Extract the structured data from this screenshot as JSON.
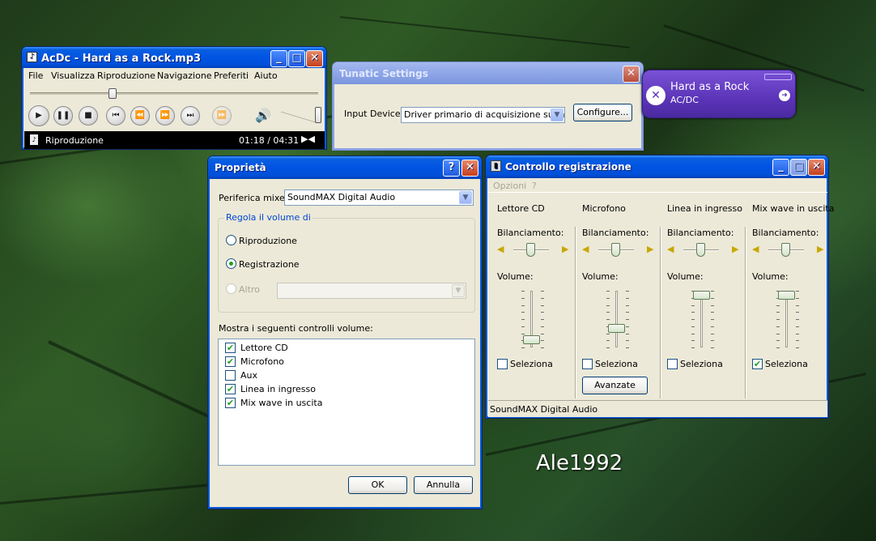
{
  "desktop": {
    "watermark": "Ale1992"
  },
  "wmp": {
    "title": "AcDc - Hard as a Rock.mp3",
    "menu": [
      "File",
      "Visualizza",
      "Riproduzione",
      "Navigazione",
      "Preferiti",
      "Aiuto"
    ],
    "status": "Riproduzione",
    "time": "01:18 / 04:31"
  },
  "tunatic": {
    "title": "Tunatic Settings",
    "input_label": "Input Device:",
    "input_value": "Driver primario di acquisizione suoni",
    "configure_label": "Configure..."
  },
  "tunatic_widget": {
    "song": "Hard as a Rock",
    "artist": "AC/DC"
  },
  "proprieta": {
    "title": "Proprietà",
    "mixer_label": "Periferica mixer:",
    "mixer_value": "SoundMAX Digital Audio",
    "group_title": "Regola il volume di",
    "radio_playback": "Riproduzione",
    "radio_record": "Registrazione",
    "radio_other": "Altro",
    "list_title": "Mostra i seguenti controlli volume:",
    "items": [
      {
        "label": "Lettore CD",
        "checked": true
      },
      {
        "label": "Microfono",
        "checked": true
      },
      {
        "label": "Aux",
        "checked": false
      },
      {
        "label": "Linea in ingresso",
        "checked": true
      },
      {
        "label": "Mix wave in uscita",
        "checked": true
      }
    ],
    "ok_label": "OK",
    "cancel_label": "Annulla"
  },
  "controllo": {
    "title": "Controllo registrazione",
    "menu": [
      "Opzioni",
      "?"
    ],
    "balance_label": "Bilanciamento:",
    "volume_label": "Volume:",
    "select_label": "Seleziona",
    "advanced_label": "Avanzate",
    "status": "SoundMAX Digital Audio",
    "channels": [
      {
        "name": "Lettore CD",
        "selected": false,
        "volume": 0.05
      },
      {
        "name": "Microfono",
        "selected": false,
        "volume": 0.3
      },
      {
        "name": "Linea in ingresso",
        "selected": false,
        "volume": 1.0
      },
      {
        "name": "Mix wave in uscita",
        "selected": true,
        "volume": 1.0
      }
    ]
  },
  "colors": {
    "titlebar": "#0054e3",
    "face": "#ece9d8",
    "check": "#21a121",
    "tunatic_purple": "#6a3fc4"
  }
}
